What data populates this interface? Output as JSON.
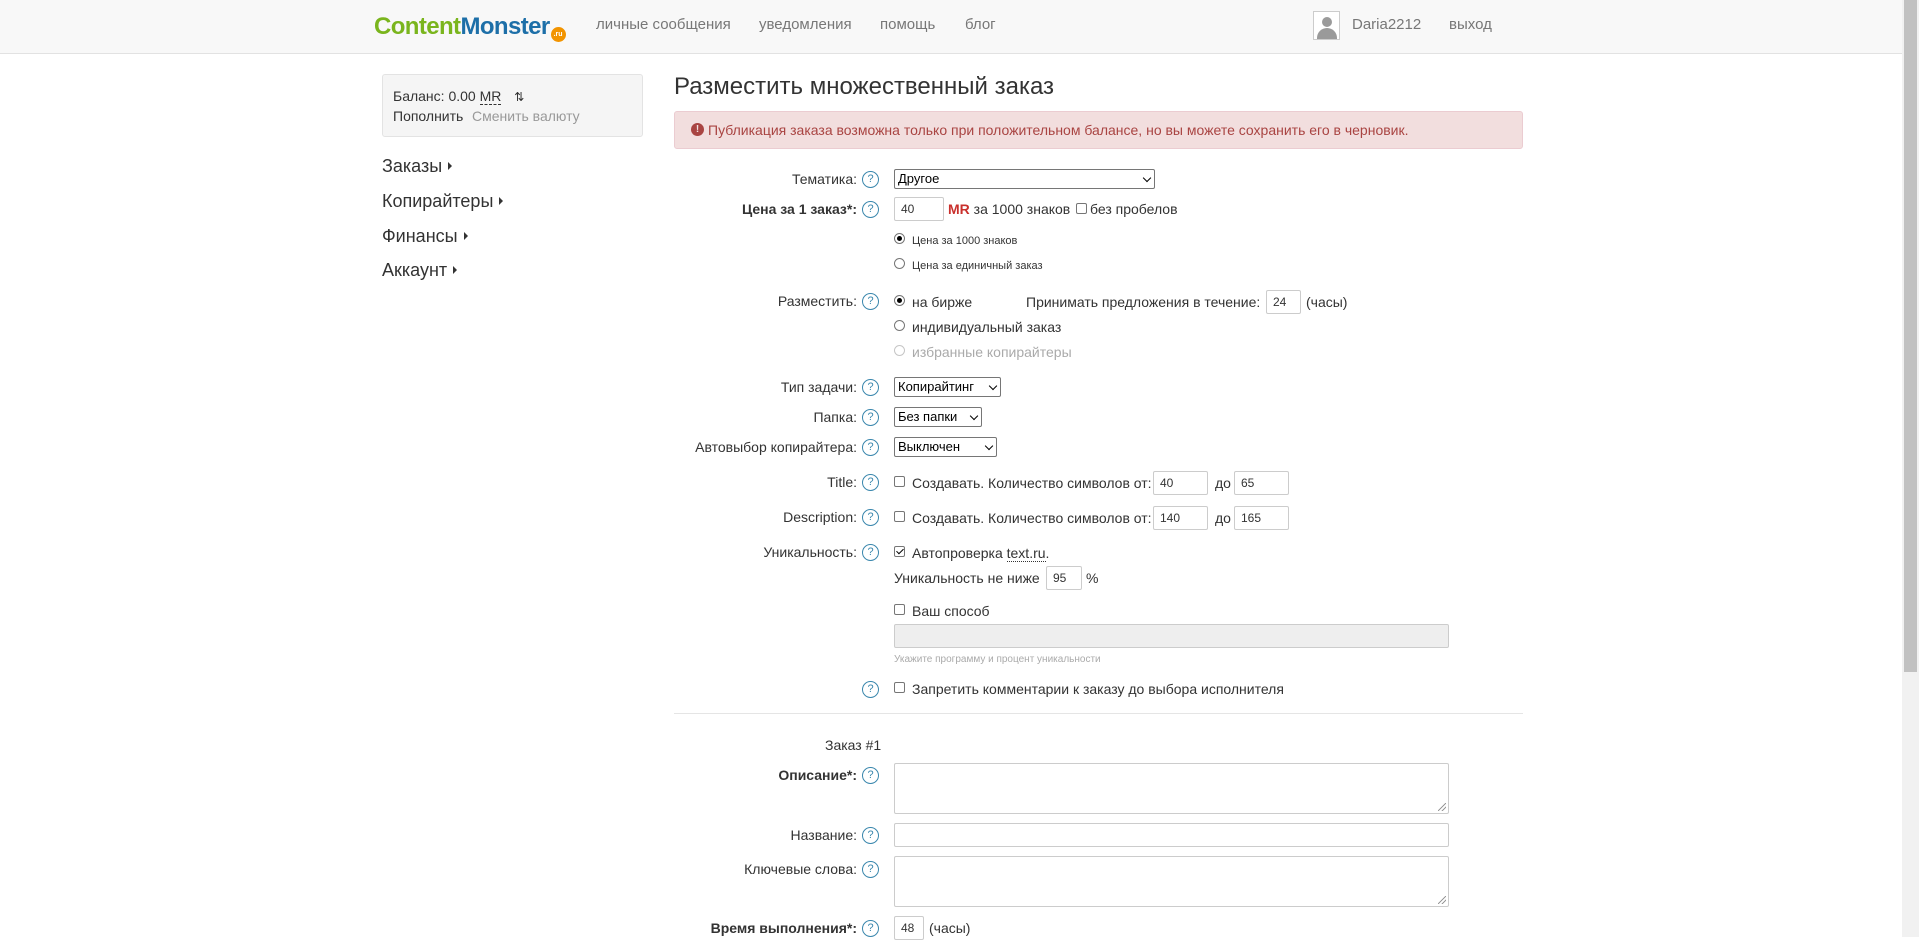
{
  "navbar": {
    "logo_part1": "Content",
    "logo_part2": "Monster",
    "logo_badge": ".ru",
    "links": [
      "личные сообщения",
      "уведомления",
      "помощь",
      "блог"
    ],
    "username": "Daria2212",
    "logout": "выход"
  },
  "sidebar": {
    "balance_label": "Баланс: 0.00",
    "balance_currency": "MR",
    "topup": "Пополнить",
    "change_currency": "Сменить валюту",
    "menu": [
      "Заказы",
      "Копирайтеры",
      "Финансы",
      "Аккаунт"
    ]
  },
  "main": {
    "title": "Разместить множественный заказ",
    "alert": "Публикация заказа возможна только при положительном балансе, но вы можете сохранить его в черновик.",
    "help_glyph": "?",
    "topic": {
      "label": "Тематика:",
      "value": "Другое"
    },
    "price": {
      "label": "Цена за 1 заказ*:",
      "value": "40",
      "currency": "MR",
      "per": "за 1000 знаков",
      "no_spaces": "без пробелов",
      "opt1": "Цена за 1000 знаков",
      "opt2": "Цена за единичный заказ"
    },
    "placement": {
      "label": "Разместить:",
      "opt1": "на бирже",
      "opt2": "индивидуальный заказ",
      "opt3": "избранные копирайтеры",
      "accept_label": "Принимать предложения в течение:",
      "accept_value": "24",
      "hours": "(часы)"
    },
    "task_type": {
      "label": "Тип задачи:",
      "value": "Копирайтинг"
    },
    "folder": {
      "label": "Папка:",
      "value": "Без папки"
    },
    "autoselect": {
      "label": "Автовыбор копирайтера:",
      "value": "Выключен"
    },
    "title_field": {
      "label": "Title:",
      "text": "Создавать. Количество символов от:",
      "from": "40",
      "to_label": "до",
      "to": "65"
    },
    "description_field": {
      "label": "Description:",
      "text": "Создавать. Количество символов от:",
      "from": "140",
      "to_label": "до",
      "to": "165"
    },
    "uniqueness": {
      "label": "Уникальность:",
      "autocheck": "Автопроверка",
      "service": "text.ru",
      "min_label": "Уникальность не ниже",
      "min_value": "95",
      "percent": "%",
      "own_method": "Ваш способ",
      "hint": "Укажите программу и процент уникальности"
    },
    "forbid_comments": "Запретить комментарии к заказу до выбора исполнителя",
    "order": {
      "heading": "Заказ #1",
      "description_label": "Описание*:",
      "name_label": "Название:",
      "keywords_label": "Ключевые слова:",
      "time_label": "Время выполнения*:",
      "time_value": "48",
      "hours": "(часы)"
    }
  }
}
